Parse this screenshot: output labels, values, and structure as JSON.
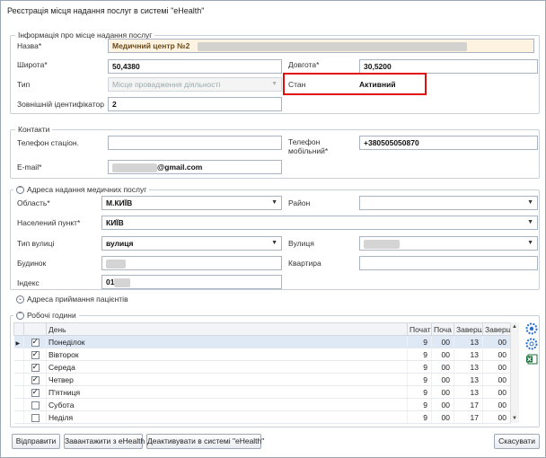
{
  "window": {
    "title": "Реєстрація місця надання послуг в системі \"eHealth\""
  },
  "info": {
    "legend": "Інформація про місце надання послуг",
    "name_label": "Назва*",
    "name_value": "Медичний центр №2",
    "lat_label": "Широта*",
    "lat_value": "50,4380",
    "lon_label": "Довгота*",
    "lon_value": "30,5200",
    "type_label": "Тип",
    "type_value": "Місце провадження діяльності",
    "status_label": "Стан",
    "status_value": "Активний",
    "extid_label": "Зовнішній ідентифікатор",
    "extid_value": "2"
  },
  "contacts": {
    "legend": "Контакти",
    "phone_label": "Телефон стаціон.",
    "phone_value": "",
    "mobile_label": "Телефон мобільний*",
    "mobile_value": "+380505050870",
    "email_label": "E-mail*",
    "email_value": "@gmail.com"
  },
  "address": {
    "legend": "Адреса надання медичних послуг",
    "region_label": "Область*",
    "region_value": "М.КИЇВ",
    "district_label": "Район",
    "district_value": "",
    "settlement_label": "Населений пункт*",
    "settlement_value": "КИЇВ",
    "street_type_label": "Тип вулиці",
    "street_type_value": "вулиця",
    "street_label": "Вулиця",
    "building_label": "Будинок",
    "apartment_label": "Квартира",
    "index_label": "Індекс",
    "index_value": "01"
  },
  "patients_address": {
    "legend": "Адреса приймання пацієнтів"
  },
  "hours": {
    "legend": "Робочі години",
    "columns": [
      "День",
      "Почат",
      "Поча",
      "Заверш",
      "Заверш"
    ],
    "rows": [
      {
        "day": "Понеділок",
        "h1": "9",
        "m1": "00",
        "h2": "13",
        "m2": "00",
        "checked": true
      },
      {
        "day": "Вівторок",
        "h1": "9",
        "m1": "00",
        "h2": "13",
        "m2": "00",
        "checked": true
      },
      {
        "day": "Середа",
        "h1": "9",
        "m1": "00",
        "h2": "13",
        "m2": "00",
        "checked": true
      },
      {
        "day": "Четвер",
        "h1": "9",
        "m1": "00",
        "h2": "13",
        "m2": "00",
        "checked": true
      },
      {
        "day": "П'ятниця",
        "h1": "9",
        "m1": "00",
        "h2": "13",
        "m2": "00",
        "checked": true
      },
      {
        "day": "Субота",
        "h1": "9",
        "m1": "00",
        "h2": "17",
        "m2": "00",
        "checked": false
      },
      {
        "day": "Неділя",
        "h1": "9",
        "m1": "00",
        "h2": "17",
        "m2": "00",
        "checked": false
      }
    ]
  },
  "buttons": {
    "send": "Відправити",
    "load": "Завантажити з eHealth",
    "deactivate": "Деактивувати в системі \"eHealth\"",
    "cancel": "Скасувати"
  },
  "colors": {
    "highlight_border": "#e01010",
    "selected_row": "#dfe8f5",
    "name_field_bg": "#fdf3e0"
  }
}
